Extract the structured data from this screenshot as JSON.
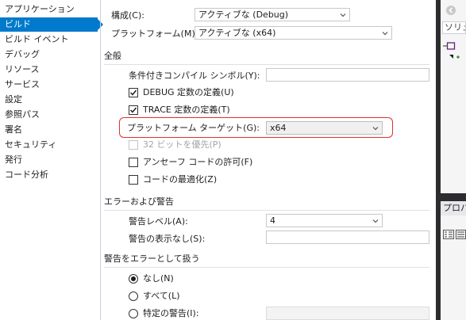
{
  "sidebar": {
    "items": [
      {
        "label": "アプリケーション"
      },
      {
        "label": "ビルド"
      },
      {
        "label": "ビルド イベント"
      },
      {
        "label": "デバッグ"
      },
      {
        "label": "リソース"
      },
      {
        "label": "サービス"
      },
      {
        "label": "設定"
      },
      {
        "label": "参照パス"
      },
      {
        "label": "署名"
      },
      {
        "label": "セキュリティ"
      },
      {
        "label": "発行"
      },
      {
        "label": "コード分析"
      }
    ],
    "selected_index": 1
  },
  "top": {
    "config_label": "構成(C):",
    "config_value": "アクティブな (Debug)",
    "platform_label": "プラットフォーム(M):",
    "platform_value": "アクティブな (x64)"
  },
  "general": {
    "header": "全般",
    "conditional_symbols_label": "条件付きコンパイル シンボル(Y):",
    "conditional_symbols_value": "",
    "define_debug_label": "DEBUG 定数の定義(U)",
    "define_debug_checked": true,
    "define_trace_label": "TRACE 定数の定義(T)",
    "define_trace_checked": true,
    "platform_target_label": "プラットフォーム ターゲット(G):",
    "platform_target_value": "x64",
    "prefer32_label": "32 ビットを優先(P)",
    "prefer32_checked": false,
    "unsafe_label": "アンセーフ コードの許可(F)",
    "unsafe_checked": false,
    "optimize_label": "コードの最適化(Z)",
    "optimize_checked": false
  },
  "errors": {
    "header": "エラーおよび警告",
    "warning_level_label": "警告レベル(A):",
    "warning_level_value": "4",
    "suppress_label": "警告の表示なし(S):",
    "suppress_value": ""
  },
  "treat_warnings": {
    "header": "警告をエラーとして扱う",
    "none_label": "なし(N)",
    "all_label": "すべて(L)",
    "specific_label": "特定の警告(I):",
    "selected": "none"
  },
  "right_panel": {
    "solution_search_text": "ソリュ",
    "properties_title": "プロパ"
  },
  "colors": {
    "accent": "#007acc",
    "highlight": "#e03030",
    "dark_frame": "#2d2d30"
  }
}
